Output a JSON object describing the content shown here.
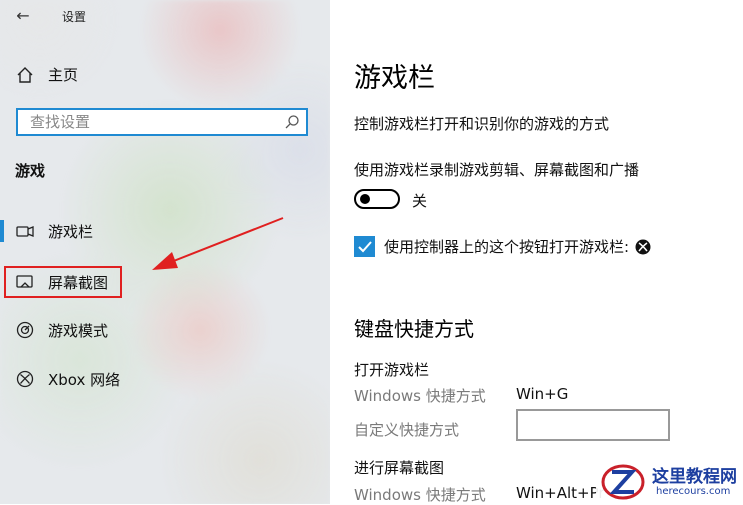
{
  "window": {
    "back_glyph": "←",
    "title": "设置"
  },
  "sidebar": {
    "home_label": "主页",
    "search_placeholder": "查找设置",
    "group_title": "游戏",
    "items": [
      {
        "label": "游戏栏",
        "icon": "game-bar-icon",
        "active": true
      },
      {
        "label": "屏幕截图",
        "icon": "screenshot-icon",
        "active": false
      },
      {
        "label": "游戏模式",
        "icon": "game-mode-icon",
        "active": false
      },
      {
        "label": "Xbox 网络",
        "icon": "xbox-icon",
        "active": false
      }
    ]
  },
  "content": {
    "title": "游戏栏",
    "description": "控制游戏栏打开和识别你的游戏的方式",
    "record_label": "使用游戏栏录制游戏剪辑、屏幕截图和广播",
    "toggle_state": "关",
    "checkbox_label": "使用控制器上的这个按钮打开游戏栏:",
    "shortcuts_title": "键盘快捷方式",
    "open_bar": {
      "title": "打开游戏栏",
      "windows_label": "Windows 快捷方式",
      "windows_value": "Win+G",
      "custom_label": "自定义快捷方式",
      "custom_value": ""
    },
    "screenshot": {
      "title": "进行屏幕截图",
      "windows_label": "Windows 快捷方式",
      "windows_value": "Win+Alt+Pr"
    }
  },
  "watermark": {
    "line1": "这里教程网",
    "line2": "herecours.com"
  },
  "colors": {
    "accent": "#1f8ad2",
    "highlight": "#e02020",
    "watermark": "#1d3fa0"
  }
}
